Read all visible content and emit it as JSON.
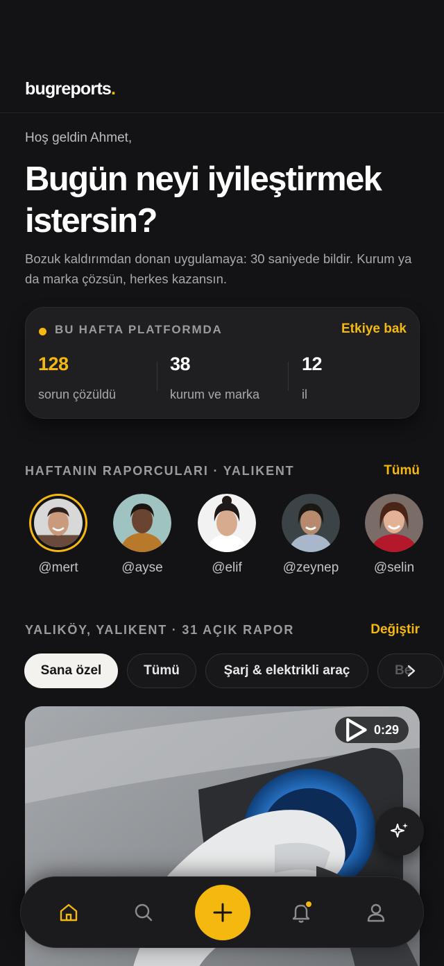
{
  "app": {
    "logo_text": "bugreports",
    "logo_dot": "."
  },
  "greeting": "Hoş geldin Ahmet,",
  "headline": "Bugün neyi iyileştirmek istersin?",
  "subtext": "Bozuk kaldırımdan donan uygulamaya: 30 saniyede bildir. Kurum ya da marka çözsün, herkes kazansın.",
  "stats": {
    "title": "BU HAFTA PLATFORMDA",
    "link": "Etkiye bak",
    "items": [
      {
        "value": "128",
        "label": "sorun çözüldü"
      },
      {
        "value": "38",
        "label": "kurum ve marka"
      },
      {
        "value": "12",
        "label": "il"
      }
    ]
  },
  "reporters": {
    "title": "HAFTANIN RAPORCULARI · YALIKENT",
    "link": "Tümü",
    "items": [
      {
        "handle": "@mert"
      },
      {
        "handle": "@ayse"
      },
      {
        "handle": "@elif"
      },
      {
        "handle": "@zeynep"
      },
      {
        "handle": "@selin"
      }
    ]
  },
  "reports": {
    "title": "YALIKÖY, YALIKENT · 31 AÇIK RAPOR",
    "link": "Değiştir",
    "chips": [
      "Sana özel",
      "Tümü",
      "Şarj & elektrikli araç",
      "Be"
    ],
    "active_chip": "Sana özel"
  },
  "media": {
    "duration": "0:29"
  },
  "nav": {
    "items": [
      "home-icon",
      "search-icon",
      "add-icon",
      "bell-icon",
      "profile-icon"
    ],
    "active": "home-icon"
  },
  "colors": {
    "accent": "#f5b80e",
    "background": "#131315",
    "card": "#1f1f22"
  }
}
